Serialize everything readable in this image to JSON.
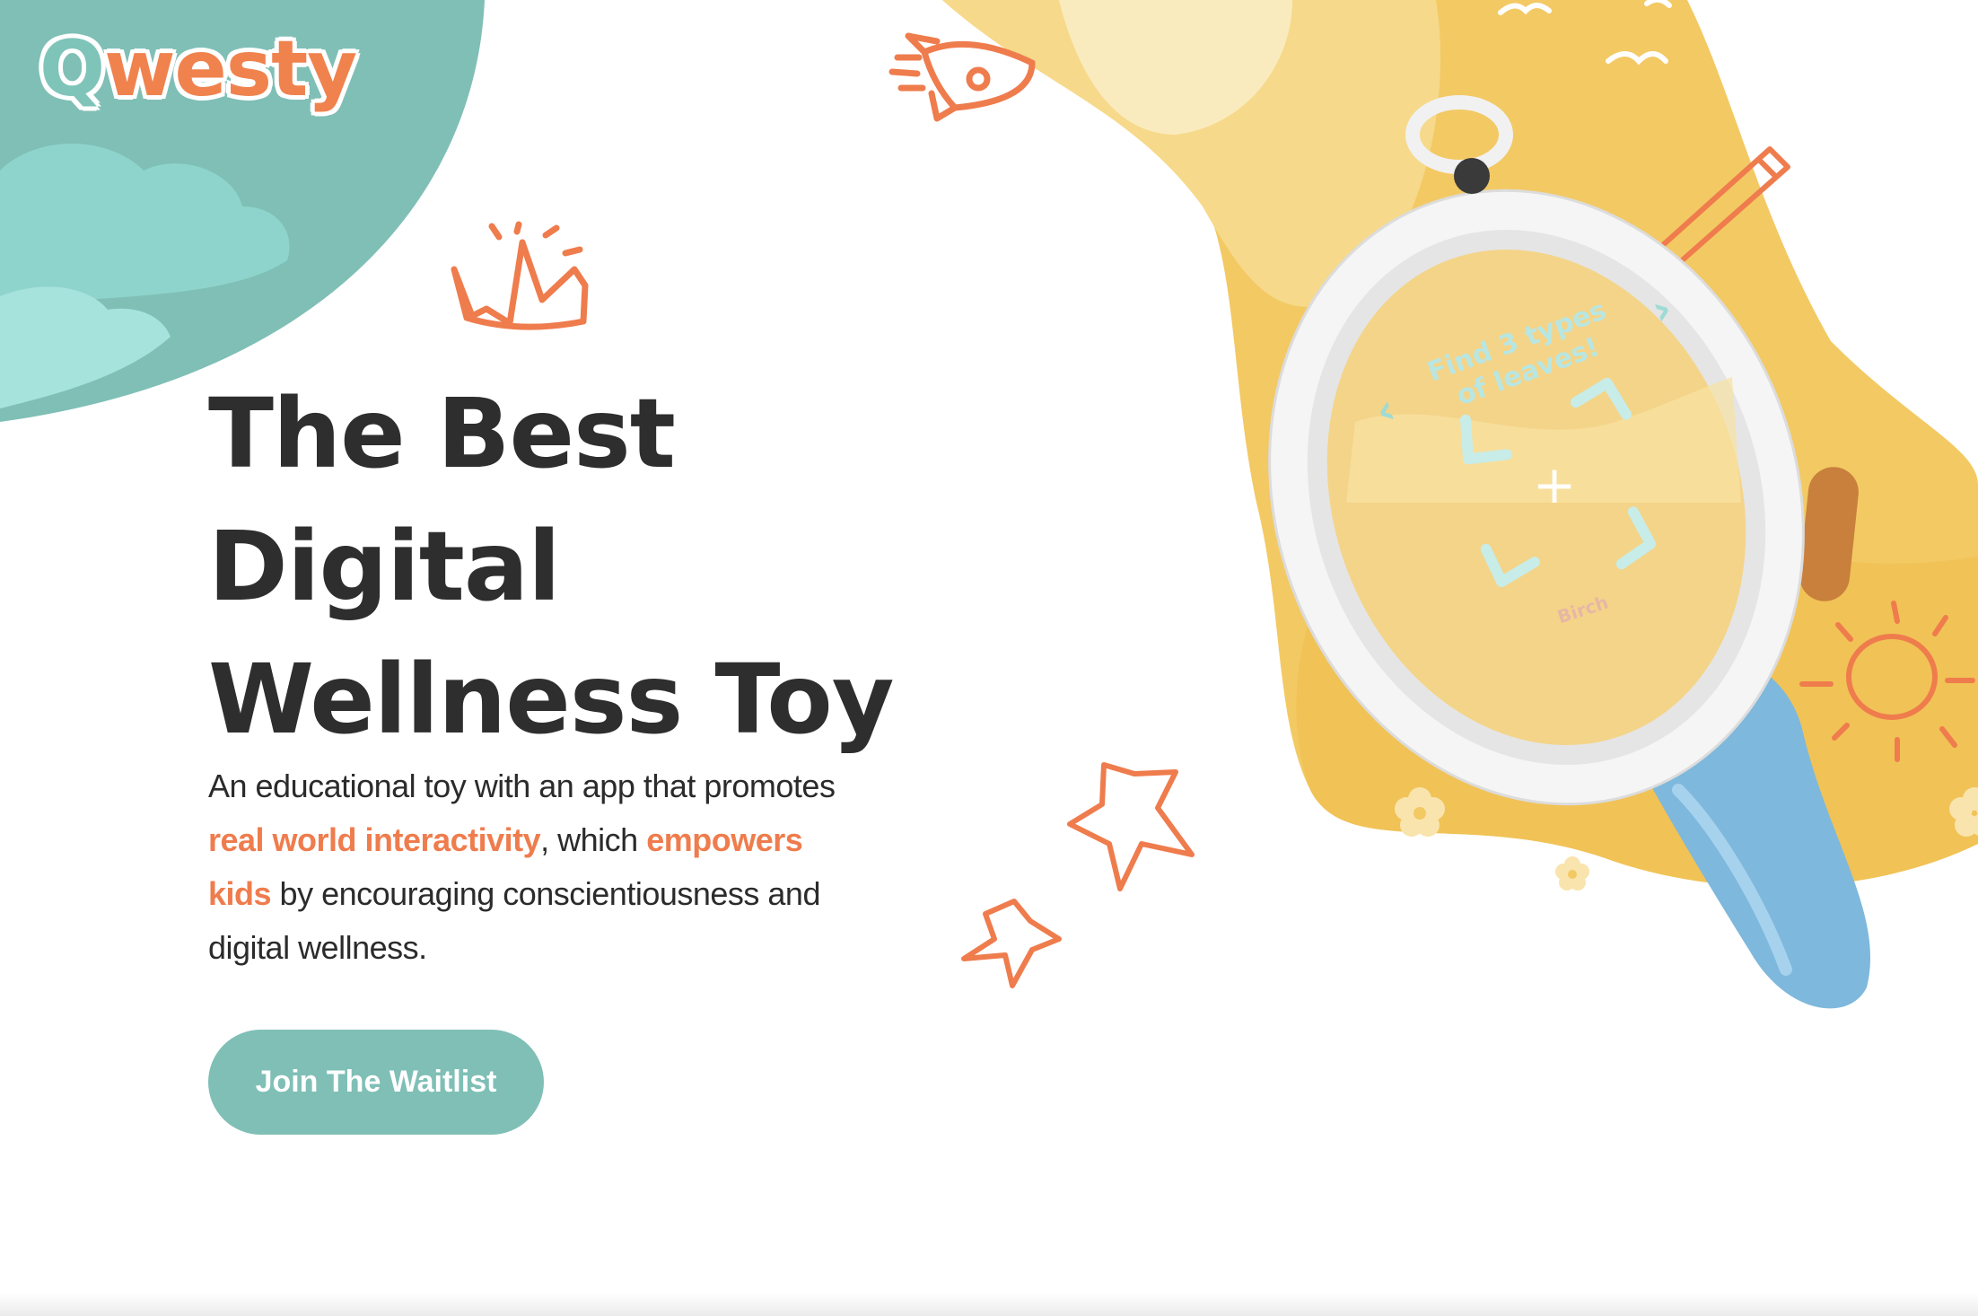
{
  "brand": {
    "logo_q": "Q",
    "logo_rest": "westy"
  },
  "hero": {
    "headline_lines": [
      "The Best",
      "Digital",
      "Wellness Toy"
    ],
    "description": {
      "part1": "An educational toy with an app that promotes ",
      "highlight1": "real world interactivity",
      "part2": ", which ",
      "highlight2": "empowers kids",
      "part3": " by encouraging conscientiousness and digital wellness."
    },
    "cta_label": "Join The Waitlist"
  },
  "device_screen": {
    "prompt_line1": "Find 3 types",
    "prompt_line2": "of leaves!",
    "prev_symbol": "‹",
    "next_symbol": "›",
    "crosshair": "+",
    "caption": "Birch"
  },
  "colors": {
    "teal": "#7fbfb6",
    "teal_light": "#a6e3dd",
    "orange_accent": "#ef7c4d",
    "yellow": "#f3c964",
    "yellow_light": "#f8e3a4",
    "handle_blue": "#7eb8dc",
    "text_dark": "#2e2e2e"
  },
  "icons": [
    "rocket-icon",
    "crown-icon",
    "star-icon",
    "sun-icon",
    "pencil-icon",
    "bird-icon",
    "flower-icon",
    "cloud-icon"
  ]
}
